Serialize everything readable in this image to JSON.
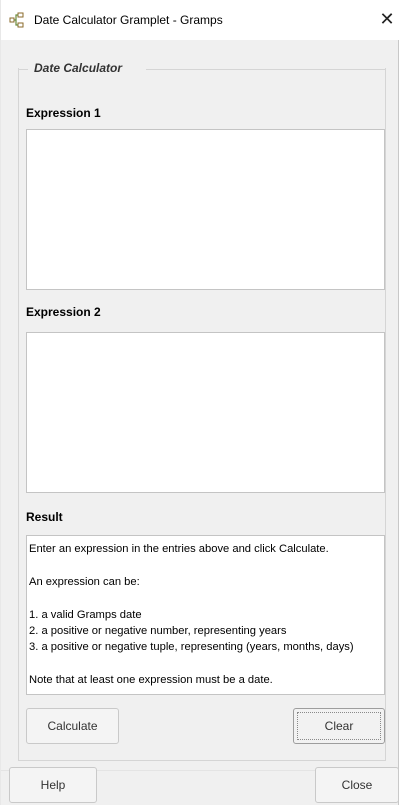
{
  "window": {
    "title": "Date Calculator Gramplet - Gramps",
    "close_glyph": "✕",
    "icon": "gramps-tree-icon"
  },
  "frame": {
    "legend": "Date Calculator"
  },
  "expression1": {
    "label": "Expression 1",
    "value": ""
  },
  "expression2": {
    "label": "Expression 2",
    "value": ""
  },
  "result": {
    "label": "Result",
    "lines": [
      "Enter an expression in the entries above and click Calculate.",
      "An expression can be:",
      "1. a valid Gramps date",
      "2. a positive or negative number, representing years",
      "3. a positive or negative tuple, representing (years, months, days)",
      "Note that at least one expression must be a date."
    ]
  },
  "buttons": {
    "calculate": "Calculate",
    "clear": "Clear",
    "help": "Help",
    "close": "Close"
  }
}
